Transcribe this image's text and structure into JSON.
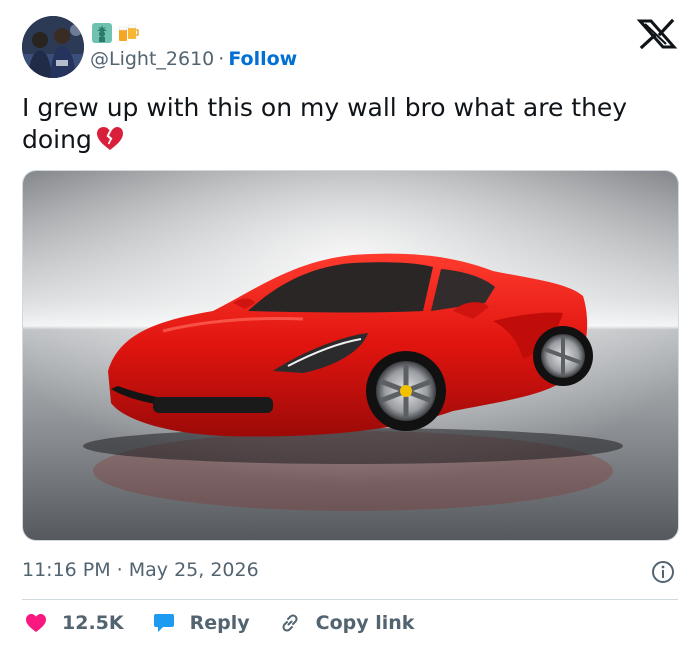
{
  "author": {
    "handle": "@Light_2610",
    "separator": "·",
    "follow_label": "Follow",
    "badge_emojis": [
      "statue-of-liberty-icon",
      "beer-mugs-icon"
    ]
  },
  "tweet": {
    "text": "I grew up with this on my wall bro what are they doing",
    "emoji": "broken-heart-icon",
    "timestamp": "11:16 PM · May 25, 2026"
  },
  "actions": {
    "likes": "12.5K",
    "reply_label": "Reply",
    "copy_link_label": "Copy link"
  },
  "colors": {
    "accent": "#006fd6",
    "like": "#f91880",
    "reply": "#1d9bf0",
    "muted": "#536471",
    "car_red": "#e0140f"
  }
}
